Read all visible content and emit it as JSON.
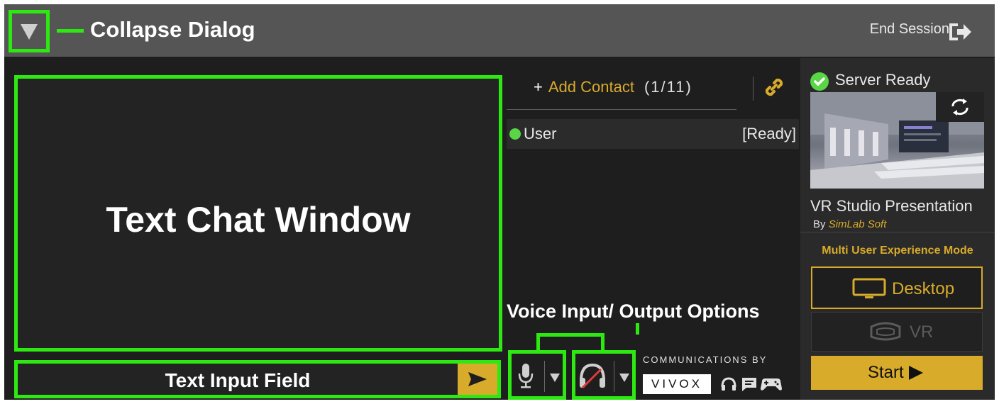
{
  "header": {
    "end_session_label": "End Session",
    "collapse_annotation": "Collapse Dialog"
  },
  "chat": {
    "window_annotation": "Text Chat Window",
    "input_annotation": "Text Input Field"
  },
  "contacts": {
    "add_plus": "+",
    "add_label": "Add Contact",
    "count": "(1/11)",
    "users": [
      {
        "name": "User",
        "status": "[Ready]",
        "status_color": "#58d646"
      }
    ]
  },
  "server": {
    "status": "Server Ready",
    "experience_title": "VR Studio Presentation",
    "by_label": "By",
    "author": "SimLab Soft"
  },
  "mode": {
    "title": "Multi User Experience Mode",
    "desktop_label": "Desktop",
    "vr_label": "VR",
    "start_label": "Start"
  },
  "voice": {
    "annotation": "Voice Input/ Output Options",
    "communications_by": "COMMUNICATIONS BY",
    "vivox": "VIVOX"
  },
  "colors": {
    "accent": "#d8ab2a",
    "annotation_green": "#2ee812",
    "ready_green": "#58d646"
  }
}
